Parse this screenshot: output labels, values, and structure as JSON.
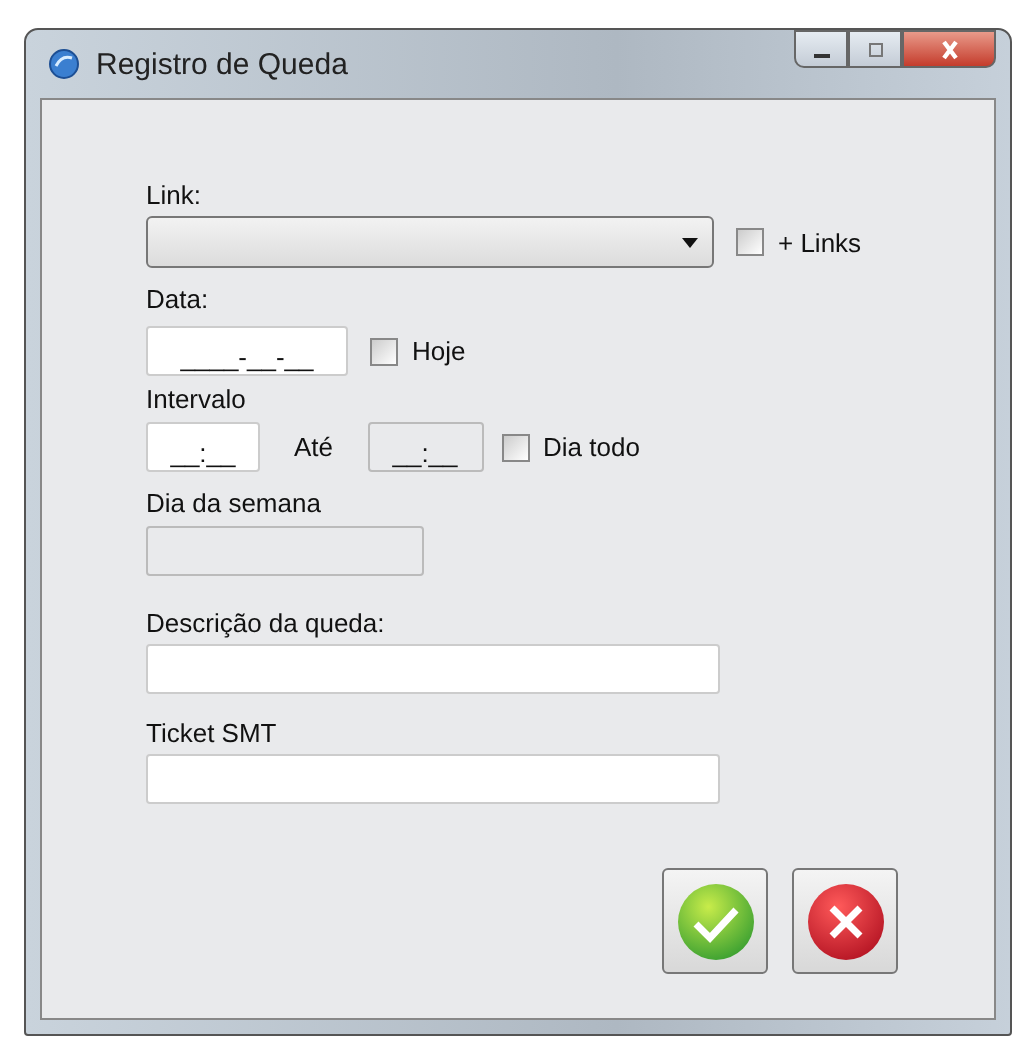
{
  "window": {
    "title": "Registro de Queda"
  },
  "link": {
    "label": "Link:",
    "checkbox": {
      "label": "+ Links",
      "checked": false
    }
  },
  "date": {
    "label": "Data:",
    "value": "____-__-__",
    "checkbox": {
      "label": "Hoje",
      "checked": false
    }
  },
  "interval": {
    "label": "Intervalo",
    "start": {
      "value": "__:__",
      "disabled": false
    },
    "separator": "Até",
    "end": {
      "value": "__:__",
      "disabled": true
    },
    "checkbox": {
      "label": "Dia todo",
      "checked": false
    }
  },
  "weekday": {
    "label": "Dia da semana",
    "disabled": true
  },
  "description": {
    "label": "Descrição da queda:"
  },
  "ticket": {
    "label": "Ticket SMT"
  }
}
